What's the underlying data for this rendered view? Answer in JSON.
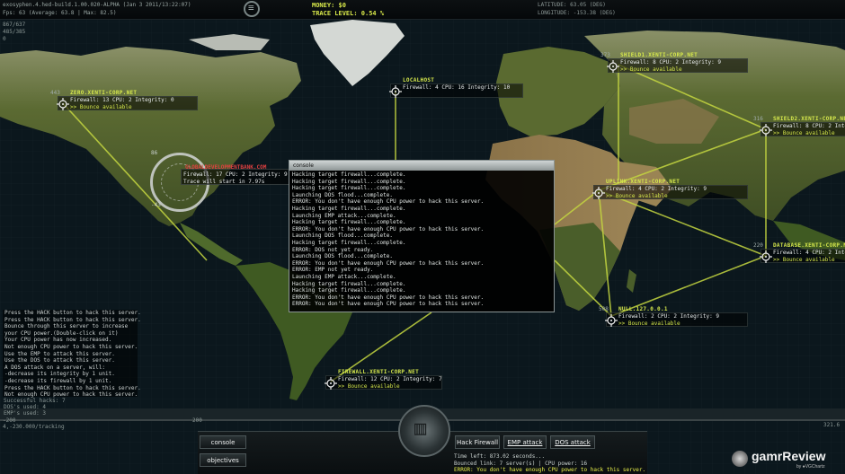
{
  "topbar": {
    "build": "exosyphen.4.hed-build.1.00.020-ALPHA (Jan  3 2011/13:22:07)",
    "fps": "Fps:  63 (Average: 63.8 | Max: 82.5)",
    "money": "MONEY: $0",
    "trace_level": "TRACE LEVEL: 0.54 %",
    "latitude": "LATITUDE: 63.05 (DEG)",
    "longitude": "LONGITUDE: -153.38 (DEG)"
  },
  "coords": [
    "867/637",
    "485/385",
    "0"
  ],
  "nodes": [
    {
      "num": "443",
      "title": "ZERO.XENTI-CORP.NET",
      "line1": "Firewall: 13 CPU: 2 Integrity: 0",
      "line2": ">> Bounce available"
    },
    {
      "num": "",
      "title": "LOCALHOST",
      "line1": "Firewall: 4 CPU: 16 Integrity: 10",
      "line2": ""
    },
    {
      "num": "373",
      "title": "SHIELD1.XENTI-CORP.NET",
      "line1": "Firewall: 8 CPU: 2 Integrity: 9",
      "line2": ">> Bounce available"
    },
    {
      "num": "316",
      "title": "SHIELD2.XENTI-CORP.NET",
      "line1": "Firewall: 8 CPU: 2 Integrity: 9",
      "line2": ">> Bounce available"
    },
    {
      "num": "",
      "title": "UPLINK.XENTI-CORP.NET",
      "line1": "Firewall: 4 CPU: 2 Integrity: 9",
      "line2": ">> Bounce available"
    },
    {
      "num": "220",
      "title": "DATABASE.XENTI-CORP.NET",
      "line1": "Firewall: 4 CPU: 2 Integrity: 9",
      "line2": ">> Bounce available"
    },
    {
      "num": "508",
      "title": "NULL.127.0.0.1",
      "line1": "Firewall: 2 CPU: 2 Integrity: 9",
      "line2": ">> Bounce available"
    },
    {
      "num": "",
      "title": "FIREWALL.XENTI-CORP.NET",
      "line1": "Firewall: 12 CPU: 2 Integrity: 7",
      "line2": ">> Bounce available"
    }
  ],
  "target": {
    "title": "GLOBALDEVELOPMENTBANK.COM",
    "line1": "Firewall: 17 CPU: 2 Integrity: 9",
    "line2": "Trace will start in 7.97s",
    "dial_top": "86",
    "dial_bottom": "-43"
  },
  "console": {
    "title": "console",
    "lines": [
      "Hacking target firewall...complete.",
      "Hacking target firewall...complete.",
      "Hacking target firewall...complete.",
      "Launching DOS flood...complete.",
      "ERROR: You don't have enough CPU power to hack this server.",
      "Hacking target firewall...complete.",
      "Launching EMP attack...complete.",
      "Hacking target firewall...complete.",
      "ERROR: You don't have enough CPU power to hack this server.",
      "Launching DOS flood...complete.",
      "Hacking target firewall...complete.",
      "ERROR: DOS not yet ready.",
      "Launching DOS flood...complete.",
      "ERROR: You don't have enough CPU power to hack this server.",
      "ERROR: EMP not yet ready.",
      "Launching EMP attack...complete.",
      "Hacking target firewall...complete.",
      "Hacking target firewall...complete.",
      "ERROR: You don't have enough CPU power to hack this server.",
      "ERROR: You don't have enough CPU power to hack this server."
    ]
  },
  "left_log": [
    "Press the HACK button to hack this server.",
    "Press the HACK button to hack this server.",
    "Bounce through this server to increase",
    "your CPU power.(Double-click on it)",
    "Your CPU power has now increased.",
    "Not enough CPU power to hack this server.",
    "Use the EMP to attack this server.",
    "Use the DOS to attack this server.",
    "A DOS attack on a server, will:",
    "-decrease its integrity by 1 unit.",
    "-decrease its firewall by 1 unit.",
    "Press the HACK button to hack this server.",
    "Not enough CPU power to hack this server."
  ],
  "stats": [
    "Successful hacks:  7",
    "DOS's used:        4",
    "EMP's used:        3"
  ],
  "ruler": {
    "left": "-200",
    "mid": "200",
    "right": "321.6",
    "tracking": "4,-230.000/tracking"
  },
  "bottom": {
    "console_btn": "console",
    "objectives_btn": "objectives",
    "hack_btn": "Hack Firewall",
    "emp_btn": "EMP attack",
    "dos_btn": "DOS attack",
    "time_left": "Time left: 873.02 seconds...",
    "bounced": "Bounced link: 7 server(s) | CPU power: 16",
    "error": "ERROR: You don't have enough CPU power to hack this server."
  },
  "watermark": {
    "name": "gamrReview",
    "sub": "by ●VGChartz"
  },
  "colors": {
    "accent": "#d6e84c",
    "link": "#c4d640",
    "ocean": "#0d1b22",
    "land": "#4b5a2c"
  }
}
